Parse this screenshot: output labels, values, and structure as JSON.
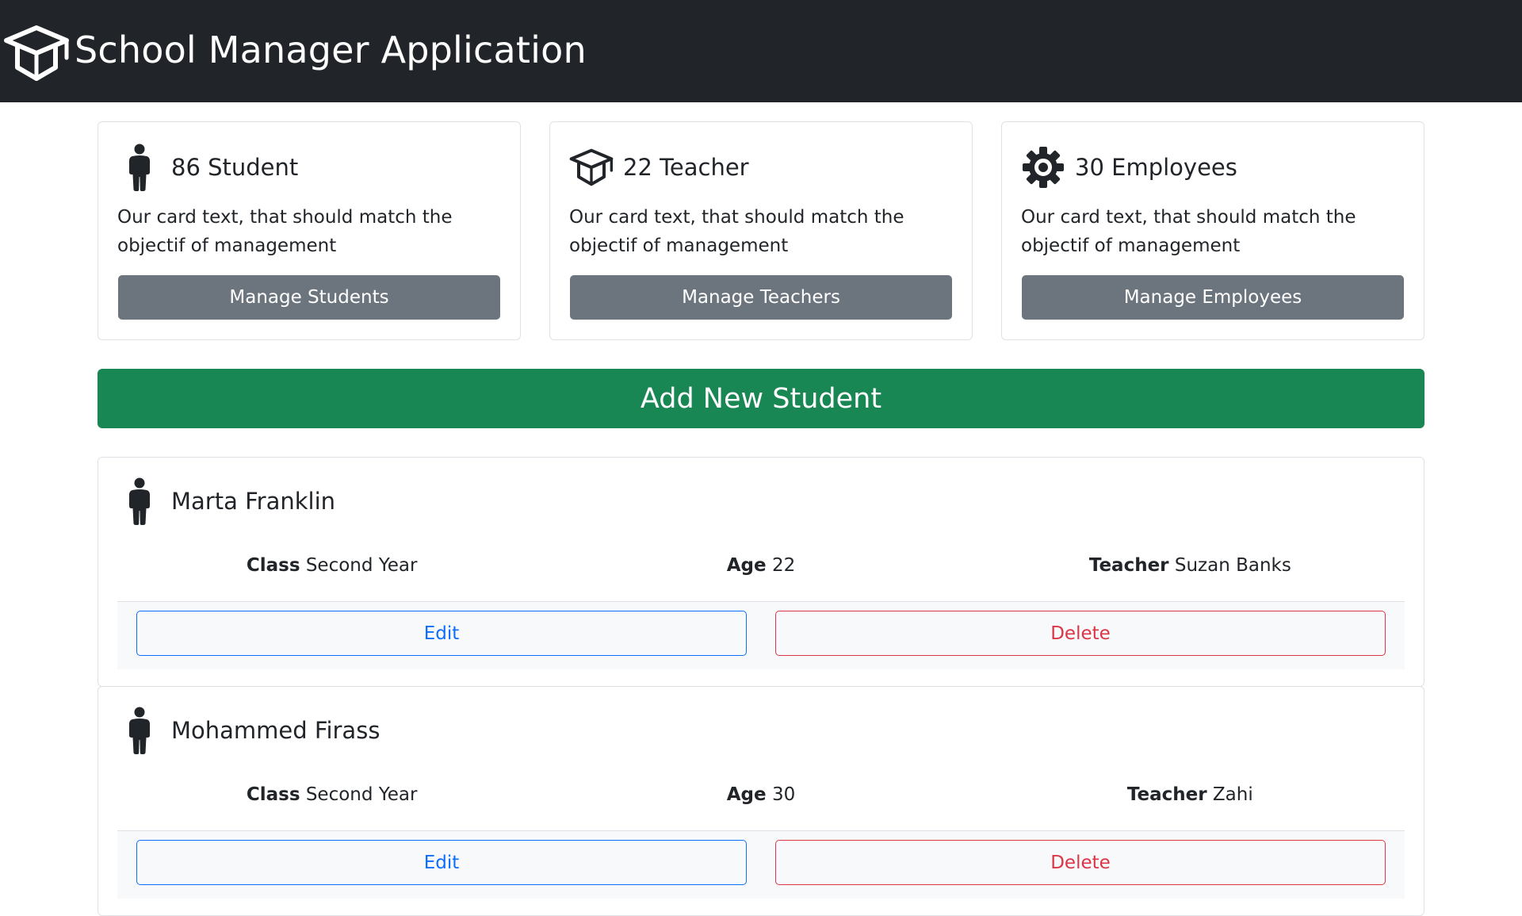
{
  "app": {
    "title": "School Manager Application",
    "logo_icon": "graduation-cap-icon"
  },
  "stats": [
    {
      "icon": "person-icon",
      "title": "86 Student",
      "text": "Our card text, that should match the objectif of management",
      "button_label": "Manage Students"
    },
    {
      "icon": "graduation-cap-icon",
      "title": "22 Teacher",
      "text": "Our card text, that should match the objectif of management",
      "button_label": "Manage Teachers"
    },
    {
      "icon": "gear-icon",
      "title": "30 Employees",
      "text": "Our card text, that should match the objectif of management",
      "button_label": "Manage Employees"
    }
  ],
  "add_button_label": "Add New Student",
  "field_labels": {
    "class": "Class",
    "age": "Age",
    "teacher": "Teacher"
  },
  "actions": {
    "edit_label": "Edit",
    "delete_label": "Delete"
  },
  "students": [
    {
      "name": "Marta Franklin",
      "class": "Second Year",
      "age": "22",
      "teacher": "Suzan Banks"
    },
    {
      "name": "Mohammed Firass",
      "class": "Second Year",
      "age": "30",
      "teacher": "Zahi"
    }
  ],
  "colors": {
    "navbar": "#212529",
    "secondary": "#6c757d",
    "success": "#198754",
    "primary": "#0d6efd",
    "danger": "#dc3545"
  }
}
